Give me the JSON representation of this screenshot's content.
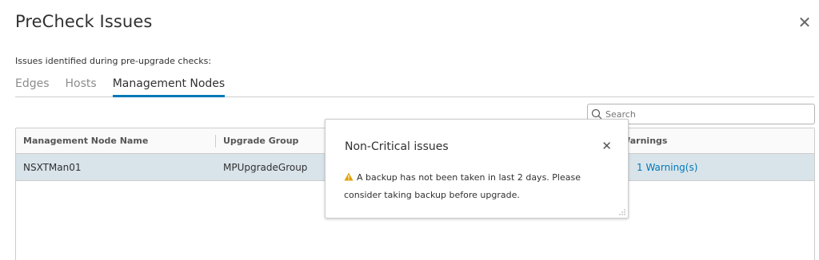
{
  "modal": {
    "title": "PreCheck Issues",
    "subtitle": "Issues identified during pre-upgrade checks:"
  },
  "tabs": [
    {
      "label": "Edges",
      "active": false
    },
    {
      "label": "Hosts",
      "active": false
    },
    {
      "label": "Management Nodes",
      "active": true
    }
  ],
  "search": {
    "placeholder": "Search",
    "value": ""
  },
  "grid": {
    "columns": [
      "Management Node Name",
      "Upgrade Group",
      "Warnings"
    ],
    "rows": [
      {
        "name": "NSXTMan01",
        "group": "MPUpgradeGroup",
        "warnings": "1 Warning(s)"
      }
    ]
  },
  "popover": {
    "title": "Non-Critical issues",
    "message": "A backup has not been taken in last 2 days. Please consider taking backup before upgrade."
  },
  "colors": {
    "accent": "#0079b8",
    "row_selected": "#d9e4ea",
    "warning": "#e0a000"
  },
  "icons": {
    "close": "close-icon",
    "search": "search-icon",
    "warning": "warning-triangle-icon",
    "resize": "resize-grip-icon"
  }
}
